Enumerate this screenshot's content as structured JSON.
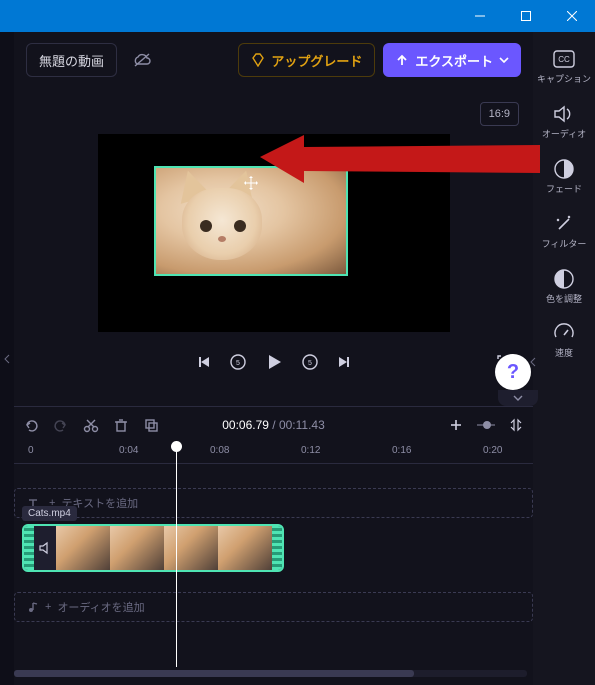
{
  "window": {
    "minimize": "—",
    "maximize": "▢",
    "close": "✕"
  },
  "toolbar": {
    "project_title": "無題の動画",
    "upgrade": "アップグレード",
    "export": "エクスポート"
  },
  "right_panel": {
    "caption": "キャプション",
    "audio": "オーディオ",
    "fade": "フェード",
    "filter": "フィルター",
    "color": "色を調整",
    "speed": "速度"
  },
  "preview": {
    "aspect_ratio": "16:9"
  },
  "time": {
    "current": "00:06",
    "current_frac": ".79",
    "total": "00:11",
    "total_frac": ".43"
  },
  "ruler": [
    "0",
    "0:04",
    "0:08",
    "0:12",
    "0:16",
    "0:20"
  ],
  "tracks": {
    "text_placeholder": "テキストを追加",
    "clip_name": "Cats.mp4",
    "audio_prefix": "+",
    "audio_placeholder": "オーディオを追加"
  },
  "help": "?"
}
